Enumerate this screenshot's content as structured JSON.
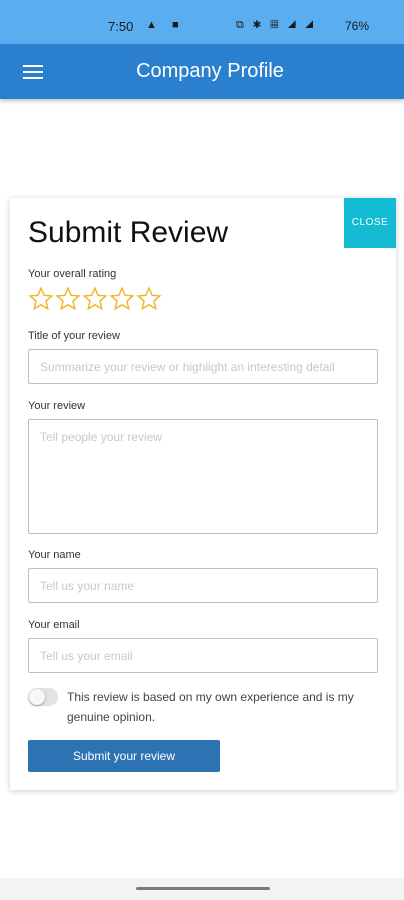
{
  "status": {
    "time": "7:50",
    "left_icons": "▲ ■",
    "right_icons": "⧉ ✱ ▦ ◢ ◢",
    "battery": "76%"
  },
  "appbar": {
    "title": "Company Profile"
  },
  "modal": {
    "title": "Submit Review",
    "close_label": "CLOSE",
    "rating_label": "Your overall rating",
    "rating_value": 0,
    "rating_max": 5,
    "title_label": "Title of your review",
    "title_placeholder": "Summarize your review or highlight an interesting detail",
    "review_label": "Your review",
    "review_placeholder": "Tell people your review",
    "name_label": "Your name",
    "name_placeholder": "Tell us your name",
    "email_label": "Your email",
    "email_placeholder": "Tell us your email",
    "consent_text": "This review is based on my own experience and is my genuine opinion.",
    "submit_label": "Submit your review"
  },
  "colors": {
    "appbar": "#2a7fcf",
    "statusbar": "#5aaef0",
    "close": "#13bcd2",
    "submit": "#2d72b3",
    "star": "#f0b429"
  }
}
